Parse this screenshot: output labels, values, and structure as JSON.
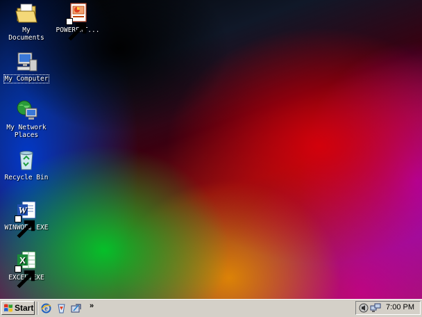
{
  "desktop": {
    "icons": [
      {
        "label": "My\nDocuments",
        "icon": "my-documents-folder-icon"
      },
      {
        "label": "POWERPNT...",
        "icon": "powerpoint-icon"
      },
      {
        "label": "My Computer",
        "icon": "my-computer-icon"
      },
      {
        "label": "My Network\nPlaces",
        "icon": "network-places-icon"
      },
      {
        "label": "Recycle Bin",
        "icon": "recycle-bin-icon"
      },
      {
        "label": "WINWORD.EXE",
        "icon": "word-icon"
      },
      {
        "label": "EXCEL.EXE",
        "icon": "excel-icon"
      }
    ]
  },
  "taskbar": {
    "start_label": "Start",
    "quick_launch": [
      "ie-icon",
      "wmp-icon",
      "show-desktop-icon"
    ],
    "overflow": "»",
    "tray_icons": [
      "volume-icon",
      "network-icon"
    ],
    "clock": "7:00 PM"
  },
  "colors": {
    "taskbar": "#d4d0c8",
    "selection": "#ffffff"
  }
}
